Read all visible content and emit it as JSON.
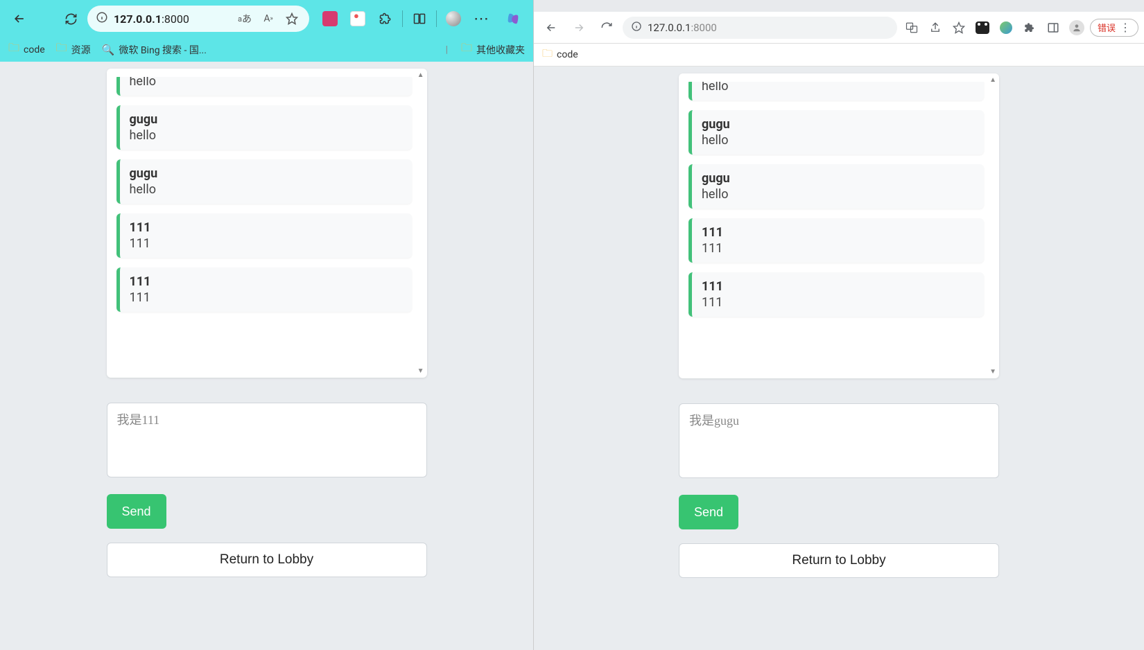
{
  "left_browser": {
    "url_ip": "127.0.0.1",
    "url_port": ":8000",
    "lang_icon": "あ",
    "bookmarks": {
      "code": "code",
      "resources": "资源",
      "bing": "微软 Bing 搜索 - 国...",
      "other": "其他收藏夹"
    }
  },
  "right_browser": {
    "url_display": "127.0.0.1",
    "url_port": ":8000",
    "error_label": "错误",
    "bookmarks": {
      "code": "code"
    }
  },
  "chat_left": {
    "messages": [
      {
        "sender": "",
        "text": "hello",
        "cut": true
      },
      {
        "sender": "gugu",
        "text": "hello"
      },
      {
        "sender": "gugu",
        "text": "hello"
      },
      {
        "sender": "111",
        "text": "111"
      },
      {
        "sender": "111",
        "text": "111"
      }
    ],
    "placeholder": "我是111",
    "send_label": "Send",
    "lobby_label": "Return to Lobby"
  },
  "chat_right": {
    "messages": [
      {
        "sender": "",
        "text": "hello",
        "cut": true
      },
      {
        "sender": "gugu",
        "text": "hello"
      },
      {
        "sender": "gugu",
        "text": "hello"
      },
      {
        "sender": "111",
        "text": "111"
      },
      {
        "sender": "111",
        "text": "111"
      }
    ],
    "placeholder": "我是gugu",
    "send_label": "Send",
    "lobby_label": "Return to Lobby"
  }
}
